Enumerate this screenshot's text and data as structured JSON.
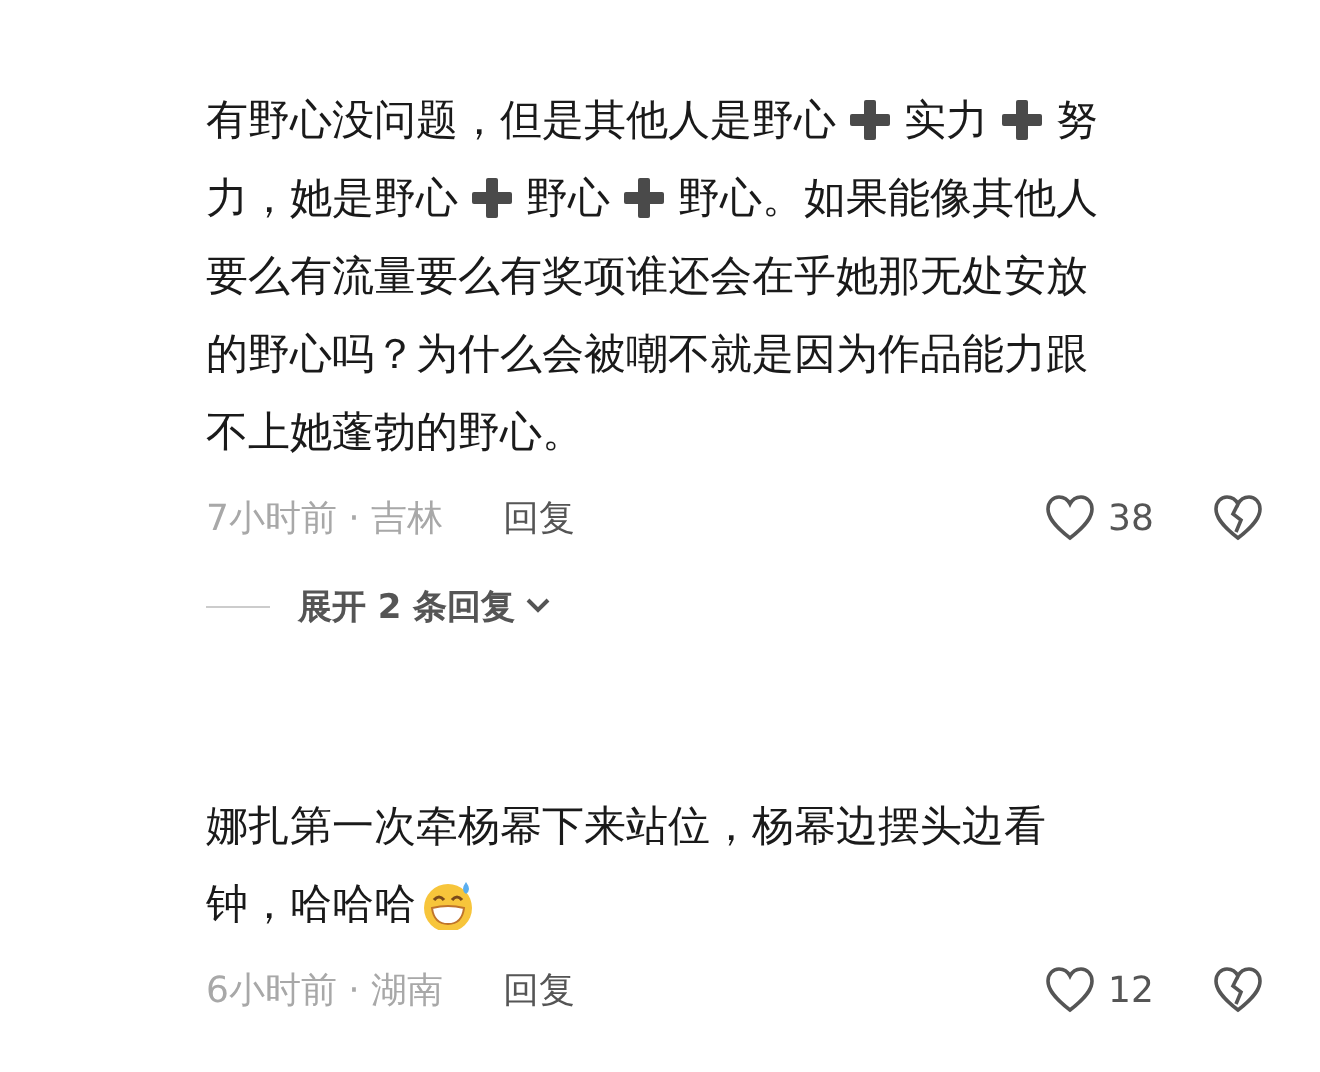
{
  "comments": [
    {
      "lines": [
        [
          {
            "kind": "text",
            "text": "有野心没问题，但是其他人是野心"
          },
          {
            "kind": "plus"
          },
          {
            "kind": "text",
            "text": "实力"
          },
          {
            "kind": "plus"
          },
          {
            "kind": "text",
            "text": "努"
          }
        ],
        [
          {
            "kind": "text",
            "text": "力，她是野心"
          },
          {
            "kind": "plus"
          },
          {
            "kind": "text",
            "text": "野心"
          },
          {
            "kind": "plus"
          },
          {
            "kind": "text",
            "text": "野心。如果能像其他人"
          }
        ],
        [
          {
            "kind": "text",
            "text": "要么有流量要么有奖项谁还会在乎她那无处安放"
          }
        ],
        [
          {
            "kind": "text",
            "text": "的野心吗？为什么会被嘲不就是因为作品能力跟"
          }
        ],
        [
          {
            "kind": "text",
            "text": "不上她蓬勃的野心。"
          }
        ]
      ],
      "meta": "7小时前 · 吉林",
      "reply": "回复",
      "likes": "38",
      "expand": "展开 2 条回复"
    },
    {
      "lines": [
        [
          {
            "kind": "text",
            "text": "娜扎第一次牵杨幂下来站位，杨幂边摆头边看"
          }
        ],
        [
          {
            "kind": "text",
            "text": "钟，哈哈哈"
          },
          {
            "kind": "emoji"
          }
        ]
      ],
      "meta": "6小时前 · 湖南",
      "reply": "回复",
      "likes": "12"
    }
  ]
}
